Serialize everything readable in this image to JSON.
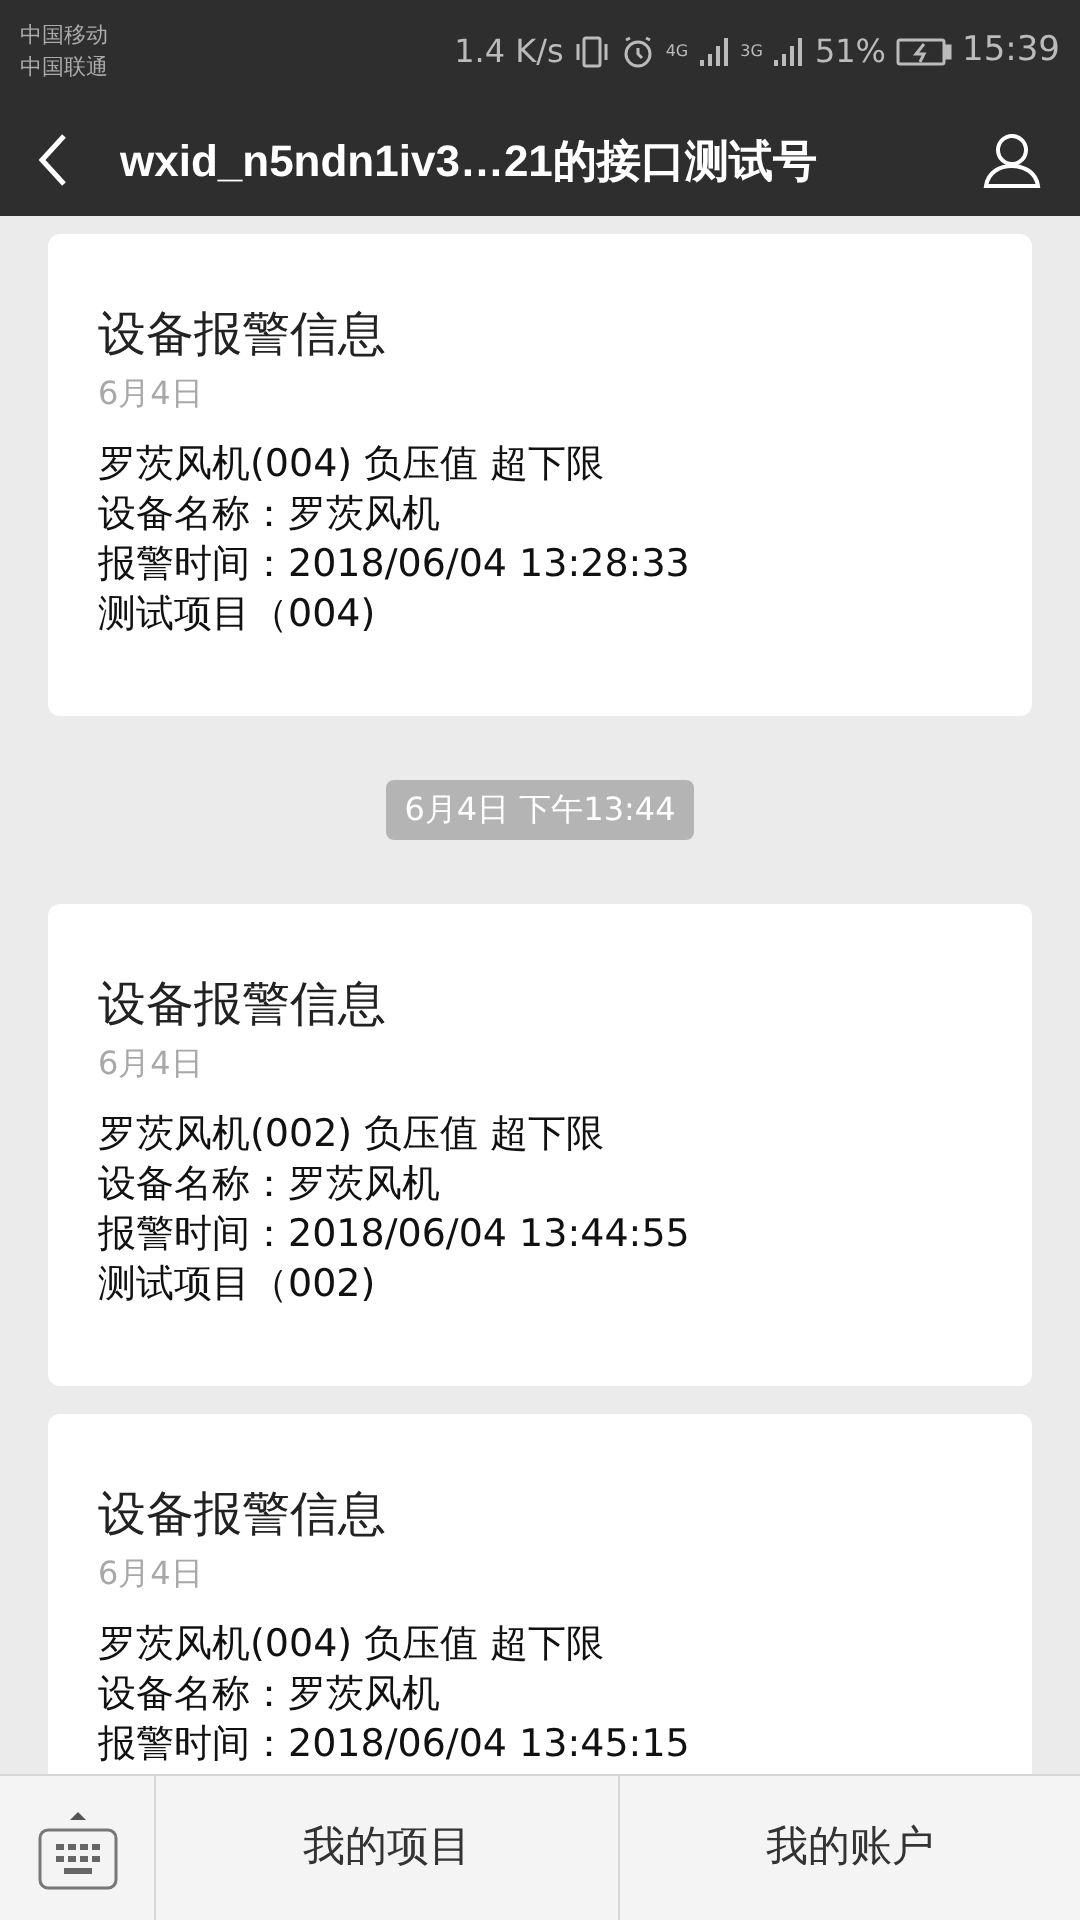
{
  "status_bar": {
    "carriers": [
      "中国移动",
      "中国联通"
    ],
    "speed": "1.4 K/s",
    "network_1": "4G",
    "network_2": "3G",
    "battery": "51%",
    "time": "15:39"
  },
  "header": {
    "title": "wxid_n5ndn1iv3…21的接口测试号"
  },
  "messages": [
    {
      "kind": "card",
      "title": "设备报警信息",
      "date": "6月4日",
      "lines": [
        "罗茨风机(004) 负压值 超下限",
        "设备名称：罗茨风机",
        "报警时间：2018/06/04 13:28:33",
        "测试项目（004)"
      ]
    },
    {
      "kind": "time",
      "text": "6月4日 下午13:44"
    },
    {
      "kind": "card",
      "title": "设备报警信息",
      "date": "6月4日",
      "lines": [
        "罗茨风机(002) 负压值 超下限",
        "设备名称：罗茨风机",
        "报警时间：2018/06/04 13:44:55",
        "测试项目（002)"
      ]
    },
    {
      "kind": "card",
      "title": "设备报警信息",
      "date": "6月4日",
      "lines": [
        "罗茨风机(004) 负压值 超下限",
        "设备名称：罗茨风机",
        "报警时间：2018/06/04 13:45:15"
      ]
    }
  ],
  "bottom_menu": [
    "我的项目",
    "我的账户"
  ]
}
